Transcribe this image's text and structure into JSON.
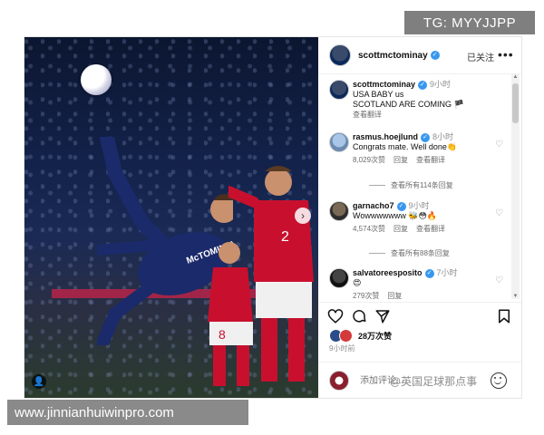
{
  "watermarks": {
    "top": "TG: MYYJJPP",
    "bottom": "www.jinnianhuiwinpro.com",
    "weibo": "@英国足球那点事"
  },
  "post": {
    "author": "scottmctominay",
    "follow_label": "已关注",
    "caption": {
      "username": "scottmctominay",
      "time": "9小时",
      "lines": [
        "USA BABY us",
        "SCOTLAND ARE COMING 🏴"
      ],
      "translate": "查看翻译"
    },
    "comments": [
      {
        "username": "rasmus.hoejlund",
        "time": "8小时",
        "text": "Congrats mate. Well done👏",
        "likes": "8,029次赞",
        "reply": "回复",
        "translate": "查看翻译",
        "view_replies": "查看所有114条回复"
      },
      {
        "username": "garnacho7",
        "time": "9小时",
        "text": "Wowwwwwww 🐝😳🔥",
        "likes": "4,574次赞",
        "reply": "回复",
        "translate": "查看翻译",
        "view_replies": "查看所有88条回复"
      },
      {
        "username": "salvatoreesposito",
        "time": "7小时",
        "text": "😍",
        "likes": "279次赞",
        "reply": "回复"
      }
    ],
    "likes_count": "28万次赞",
    "posted_ago": "9小时前",
    "comment_placeholder": "添加评论...",
    "jersey_name": "McTOMINAY",
    "jersey_number_red1": "2",
    "jersey_number_red2": "8"
  },
  "colors": {
    "verified": "#3897f0",
    "scotland_kit": "#1b2a6b",
    "denmark_kit": "#c8102e"
  },
  "icons": [
    "verified-icon",
    "more-icon",
    "heart-icon",
    "comment-icon",
    "share-icon",
    "bookmark-icon",
    "emoji-icon",
    "next-arrow-icon",
    "tag-user-icon"
  ]
}
